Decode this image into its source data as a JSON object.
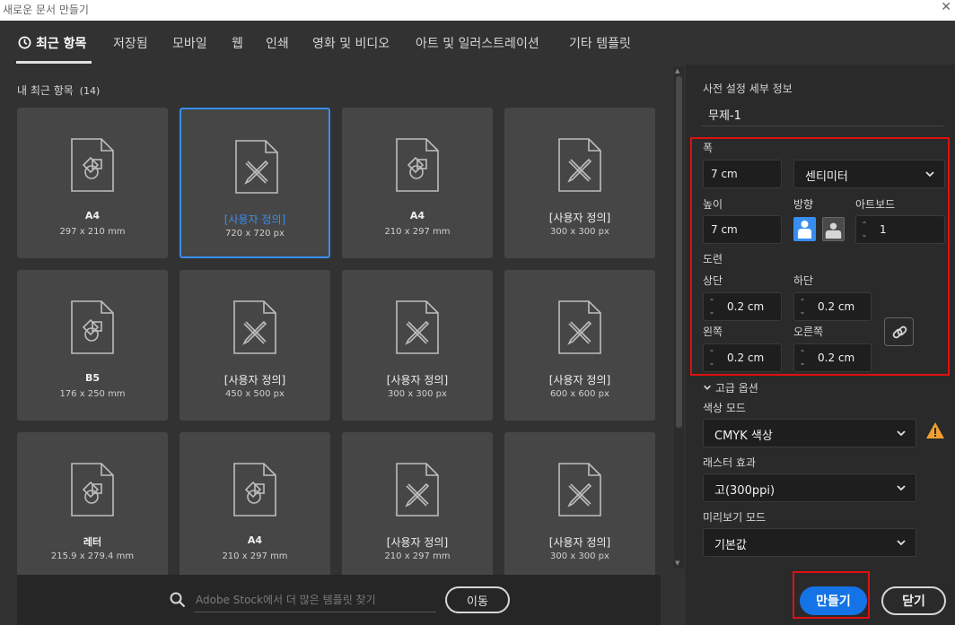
{
  "window": {
    "title": "새로운 문서 만들기",
    "close_glyph": "✕"
  },
  "tabs": [
    {
      "label": "최근 항목",
      "active": true,
      "icon": "clock-icon"
    },
    {
      "label": "저장됨"
    },
    {
      "label": "모바일"
    },
    {
      "label": "웹"
    },
    {
      "label": "인쇄"
    },
    {
      "label": "영화 및 비디오"
    },
    {
      "label": "아트 및 일러스트레이션"
    },
    {
      "label": "기타 템플릿"
    }
  ],
  "recent": {
    "heading": "내 최근 항목",
    "count": "(14)",
    "cards": [
      {
        "name": "A4",
        "size": "297 x 210 mm",
        "icon": "print-document-icon"
      },
      {
        "name": "[사용자 정의]",
        "size": "720 x 720 px",
        "icon": "art-document-icon",
        "selected": true
      },
      {
        "name": "A4",
        "size": "210 x 297 mm",
        "icon": "print-document-icon"
      },
      {
        "name": "[사용자 정의]",
        "size": "300 x 300 px",
        "icon": "art-document-icon"
      },
      {
        "name": "B5",
        "size": "176 x 250 mm",
        "icon": "print-document-icon"
      },
      {
        "name": "[사용자 정의]",
        "size": "450 x 500 px",
        "icon": "art-document-icon"
      },
      {
        "name": "[사용자 정의]",
        "size": "300 x 300 px",
        "icon": "art-document-icon"
      },
      {
        "name": "[사용자 정의]",
        "size": "600 x 600 px",
        "icon": "art-document-icon"
      },
      {
        "name": "레터",
        "size": "215.9 x 279.4 mm",
        "icon": "print-document-icon"
      },
      {
        "name": "A4",
        "size": "210 x 297 mm",
        "icon": "print-document-icon"
      },
      {
        "name": "[사용자 정의]",
        "size": "210 x 297 mm",
        "icon": "art-document-icon"
      },
      {
        "name": "[사용자 정의]",
        "size": "300 x 300 px",
        "icon": "art-document-icon"
      }
    ]
  },
  "stock": {
    "placeholder": "Adobe Stock에서 더 많은 템플릿 찾기",
    "go_label": "이동"
  },
  "details": {
    "heading": "사전 설정 세부 정보",
    "doc_name": "무제-1",
    "width_label": "폭",
    "width_value": "7 cm",
    "unit": "센티미터",
    "height_label": "높이",
    "height_value": "7 cm",
    "orientation_label": "방향",
    "orientation": "portrait",
    "artboards_label": "아트보드",
    "artboards_value": "1",
    "bleed_label": "도련",
    "bleed_top_label": "상단",
    "bleed_top": "0.2 cm",
    "bleed_bottom_label": "하단",
    "bleed_bottom": "0.2 cm",
    "bleed_left_label": "왼쪽",
    "bleed_left": "0.2 cm",
    "bleed_right_label": "오른쪽",
    "bleed_right": "0.2 cm",
    "advanced_label": "고급 옵션",
    "color_mode_label": "색상 모드",
    "color_mode": "CMYK 색상",
    "raster_label": "래스터 효과",
    "raster": "고(300ppi)",
    "preview_label": "미리보기 모드",
    "preview": "기본값"
  },
  "actions": {
    "create_label": "만들기",
    "close_label": "닫기"
  },
  "colors": {
    "accent": "#1473e6",
    "selection": "#378ef0",
    "highlight": "#e01010",
    "warning": "#f0a030"
  }
}
